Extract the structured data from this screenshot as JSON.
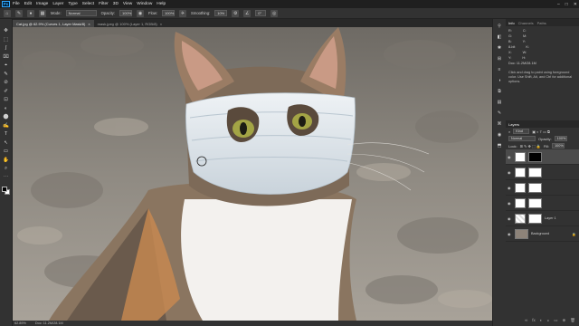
{
  "menubar": {
    "logo": "Ps",
    "items": [
      "File",
      "Edit",
      "Image",
      "Layer",
      "Type",
      "Select",
      "Filter",
      "3D",
      "View",
      "Window",
      "Help"
    ],
    "window_controls": [
      "–",
      "□",
      "✕"
    ]
  },
  "options": {
    "mode_label": "Mode:",
    "mode_value": "Normal",
    "opacity_label": "Opacity:",
    "opacity_value": "100%",
    "flow_label": "Flow:",
    "flow_value": "100%",
    "smoothing_label": "Smoothing:",
    "smoothing_value": "10%",
    "angle_value": "0°"
  },
  "tabs": [
    {
      "label": "Cat.jpg @ 62.9% (Curves 1, Layer Mask/8)",
      "close": "×"
    },
    {
      "label": "mask.jpeg @ 100% (Layer 1, RGB/8)",
      "close": "×"
    }
  ],
  "tools": [
    "✥",
    "⬚",
    "ʃ",
    "⌧",
    "⌖",
    "✎",
    "⊘",
    "✐",
    "⊡",
    "◐",
    "⬤",
    "✍",
    "T",
    "↖",
    "▭",
    "✋",
    "⌕",
    "⋯"
  ],
  "status": {
    "zoom": "62.89%",
    "doc": "Doc: 11.2M/28.1M"
  },
  "strip_icons": [
    "⚲",
    "◧",
    "✱",
    "⊞",
    "≡",
    "◑",
    "⧉",
    "▤",
    "✎",
    "⌘",
    "◉",
    "⬒"
  ],
  "right_panel": {
    "info_tabs": [
      "Info",
      "Channels",
      "Paths"
    ],
    "info_rows": [
      [
        "R:",
        "C:"
      ],
      [
        "G:",
        "M:"
      ],
      [
        "B:",
        "Y:"
      ],
      [
        "8-bit",
        "K:"
      ],
      [
        "X:",
        "W:"
      ],
      [
        "Y:",
        "H:"
      ]
    ],
    "doc_size": "Doc: 11.2M/28.1M",
    "info_text": "Click and drag to paint using foreground color. Use Shift, Alt, and Ctrl for additional options.",
    "layers_tabs": [
      "Layers"
    ],
    "kind_label": "Kind",
    "blend_mode": "Normal",
    "opacity_label": "Opacity:",
    "opacity_value": "100%",
    "lock_label": "Lock:",
    "fill_label": "Fill:",
    "fill_value": "100%",
    "layers": [
      {
        "name": "",
        "thumb_color": "#ffffff",
        "mask_color": "#000000",
        "selected": true
      },
      {
        "name": "",
        "thumb_color": "#ffffff",
        "mask_color": "#ffffff",
        "selected": false
      },
      {
        "name": "",
        "thumb_color": "#ffffff",
        "mask_color": "#ffffff",
        "selected": false
      },
      {
        "name": "",
        "thumb_color": "#ffffff",
        "mask_color": "#ffffff",
        "selected": false
      },
      {
        "name": "Layer 1",
        "thumb_color": "#dfe6ea",
        "mask_color": "#ffffff",
        "selected": false
      },
      {
        "name": "Background",
        "thumb_color": "#8d8379",
        "mask_color": "",
        "selected": false
      }
    ],
    "bottom_icons": [
      "∞",
      "fx",
      "◐",
      "◒",
      "▭",
      "⊕",
      "🗑"
    ]
  },
  "colors": {
    "accent": "#31a8ff",
    "panel": "#323232",
    "canvas_bg": "#535353"
  }
}
